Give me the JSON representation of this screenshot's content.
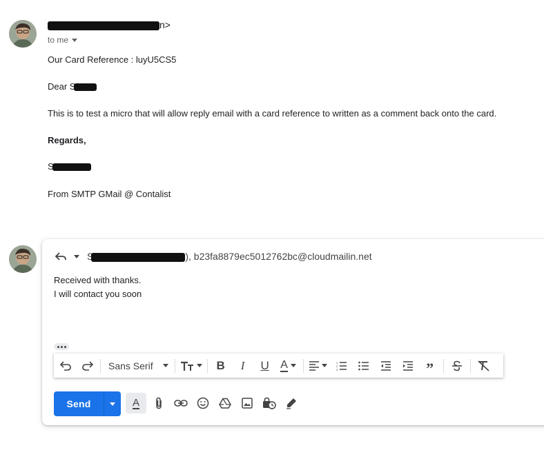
{
  "message": {
    "sender_suffix": "n>",
    "to_label": "to me",
    "lines": {
      "reference": "Our Card Reference : luyU5CS5",
      "dear": "Dear S",
      "body": "This is to test a micro that will allow reply email with a card reference to written as a comment back onto the card.",
      "regards": "Regards,",
      "signature": "S",
      "from": "From SMTP GMail @ Contalist"
    }
  },
  "reply": {
    "recipients_prefix": "S",
    "recipients_rest": "), b23fa8879ec5012762bc@cloudmailin.net",
    "body_line1": "Received with thanks.",
    "body_line2": "I will contact you soon",
    "font_name": "Sans Serif",
    "send_label": "Send"
  },
  "colors": {
    "send_blue": "#1a73e8",
    "text": "#202124",
    "muted": "#5f6368"
  },
  "icons": {
    "toolbar": [
      "undo-icon",
      "redo-icon",
      "text-size-icon",
      "bold-icon",
      "italic-icon",
      "underline-icon",
      "text-color-icon",
      "align-icon",
      "numbered-list-icon",
      "bulleted-list-icon",
      "indent-less-icon",
      "indent-more-icon",
      "quote-icon",
      "strikethrough-icon",
      "remove-formatting-icon"
    ],
    "bottom": [
      "formatting-options-icon",
      "attach-icon",
      "link-icon",
      "emoji-icon",
      "drive-icon",
      "photo-icon",
      "confidential-icon",
      "signature-icon"
    ]
  }
}
